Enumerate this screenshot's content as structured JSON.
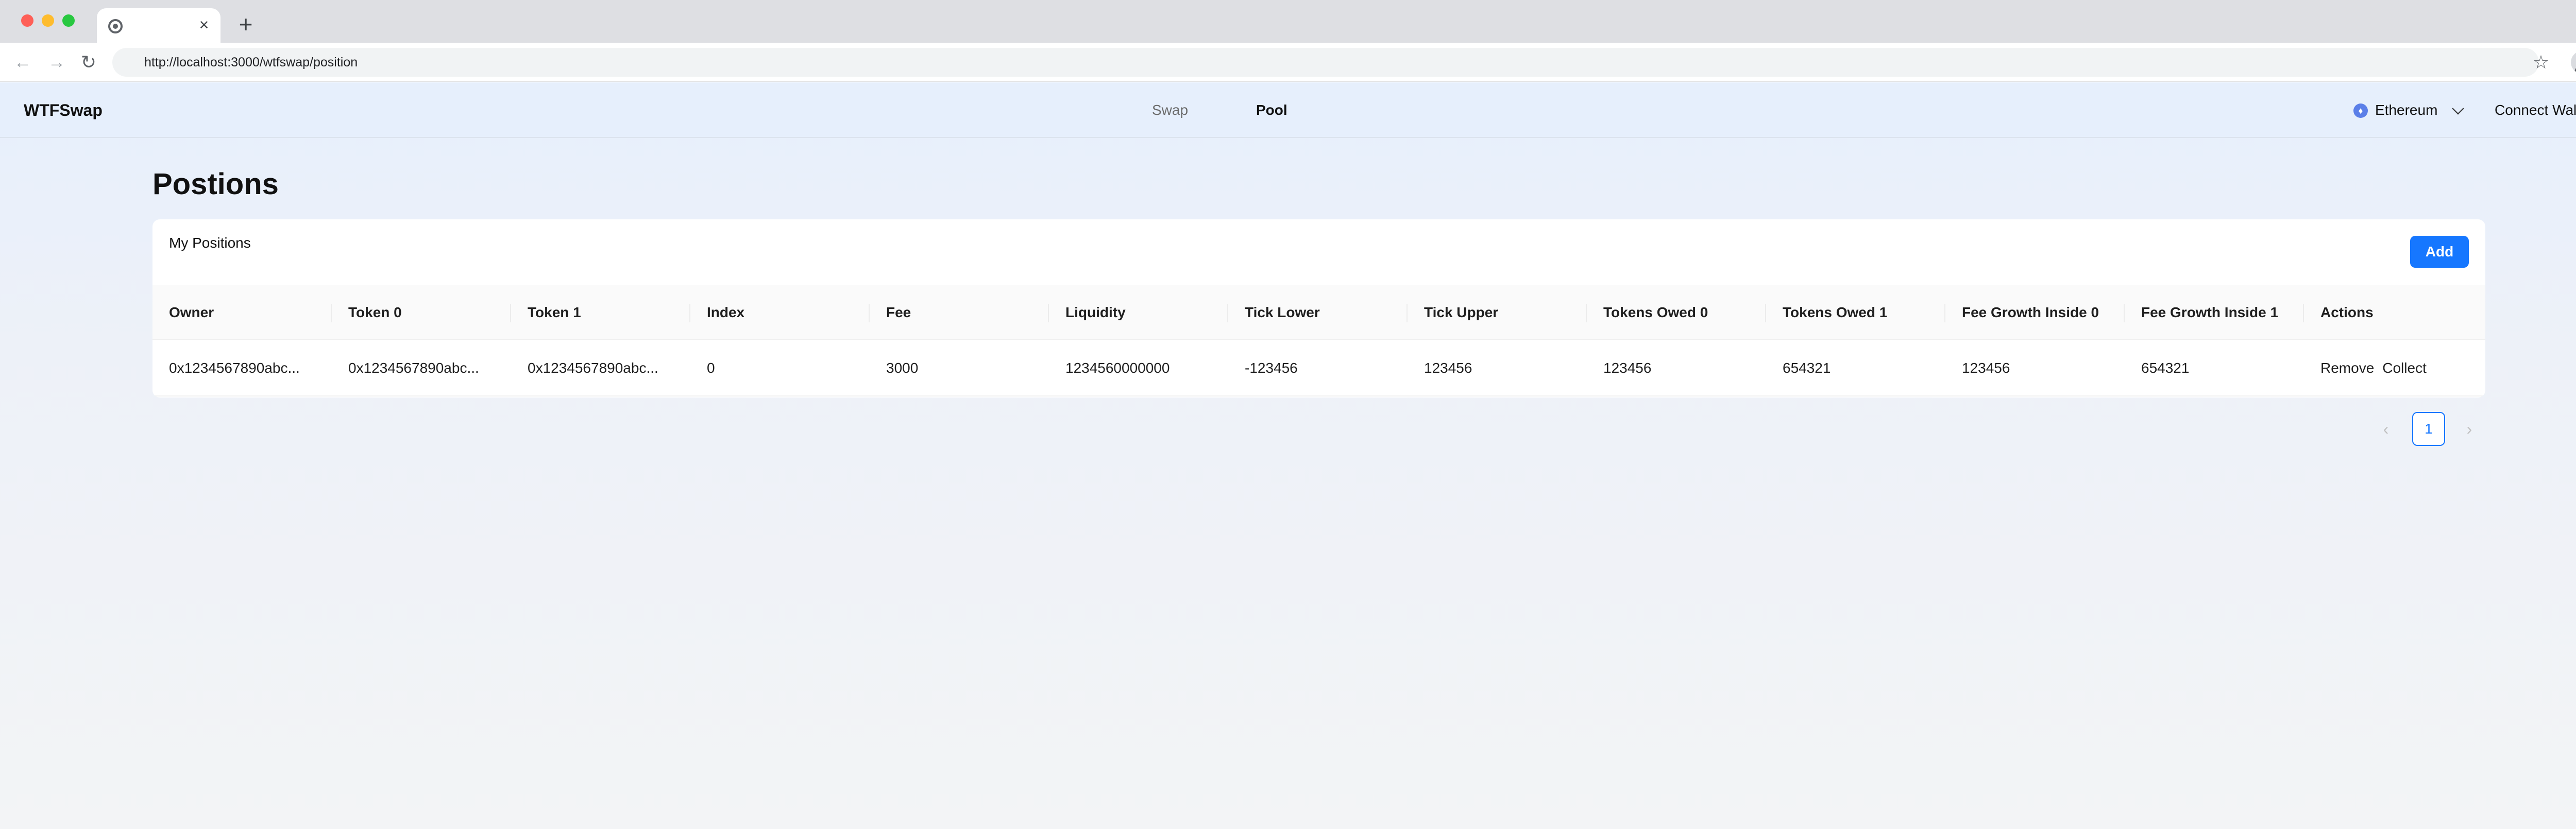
{
  "browser": {
    "tab_title": "",
    "close_glyph": "×",
    "new_tab_glyph": "+",
    "back_glyph": "←",
    "forward_glyph": "→",
    "reload_glyph": "↻",
    "url": "http://localhost:3000/wtfswap/position",
    "star_glyph": "☆",
    "menu_glyph": "⋮"
  },
  "header": {
    "logo": "WTFSwap",
    "nav": [
      {
        "label": "Swap",
        "active": false
      },
      {
        "label": "Pool",
        "active": true
      }
    ],
    "network": {
      "icon": "ethereum-icon",
      "glyph": "♦",
      "label": "Ethereum"
    },
    "connect_label": "Connect Wallet"
  },
  "main": {
    "title": "Postions",
    "card_title": "My Positions",
    "add_label": "Add",
    "table": {
      "columns": [
        "Owner",
        "Token 0",
        "Token 1",
        "Index",
        "Fee",
        "Liquidity",
        "Tick Lower",
        "Tick Upper",
        "Tokens Owed 0",
        "Tokens Owed 1",
        "Fee Growth Inside 0",
        "Fee Growth Inside 1",
        "Actions"
      ],
      "rows": [
        {
          "cells": [
            "0x1234567890abc...",
            "0x1234567890abc...",
            "0x1234567890abc...",
            "0",
            "3000",
            "1234560000000",
            "-123456",
            "123456",
            "123456",
            "654321",
            "123456",
            "654321"
          ],
          "actions": [
            "Remove",
            "Collect"
          ]
        }
      ]
    },
    "pagination": {
      "prev_glyph": "‹",
      "current_page": "1",
      "next_glyph": "›"
    }
  },
  "colors": {
    "accent": "#1677ff",
    "header_bg": "#e6effc",
    "page_bg_top": "#e7effc",
    "page_bg_bottom": "#f3f4f6"
  }
}
